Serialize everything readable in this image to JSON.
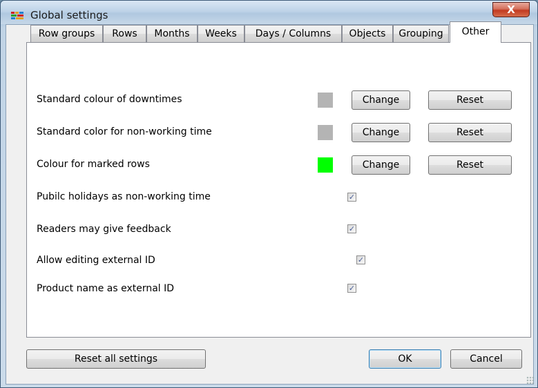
{
  "window": {
    "title": "Global settings",
    "close_glyph": "X",
    "app_icon": "app-icon"
  },
  "tabs": [
    {
      "label": "Row groups",
      "active": false
    },
    {
      "label": "Rows",
      "active": false
    },
    {
      "label": "Months",
      "active": false
    },
    {
      "label": "Weeks",
      "active": false
    },
    {
      "label": "Days / Columns",
      "active": false
    },
    {
      "label": "Objects",
      "active": false
    },
    {
      "label": "Grouping",
      "active": false
    },
    {
      "label": "Other",
      "active": true
    }
  ],
  "colour_settings": [
    {
      "label": "Standard colour of downtimes",
      "color": "#b4b4b4",
      "change_label": "Change",
      "reset_label": "Reset"
    },
    {
      "label": "Standard color for non-working time",
      "color": "#b4b4b4",
      "change_label": "Change",
      "reset_label": "Reset"
    },
    {
      "label": "Colour for marked rows",
      "color": "#00ff00",
      "change_label": "Change",
      "reset_label": "Reset"
    }
  ],
  "checkbox_settings": [
    {
      "label": "Pubilc holidays as non-working time",
      "checked": true
    },
    {
      "label": "Readers may give feedback",
      "checked": true
    },
    {
      "label": "Allow editing external ID",
      "checked": true
    },
    {
      "label": "Product name as external ID",
      "checked": true
    }
  ],
  "footer": {
    "reset_all_label": "Reset all settings",
    "ok_label": "OK",
    "cancel_label": "Cancel"
  }
}
